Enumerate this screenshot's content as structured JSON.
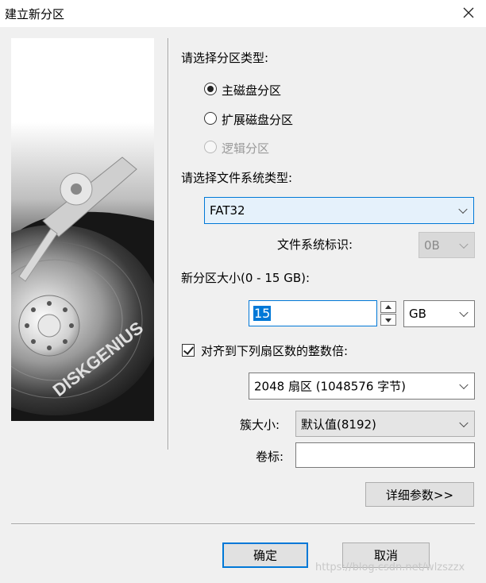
{
  "dialog": {
    "title": "建立新分区",
    "close_icon": "close-icon"
  },
  "illustration": {
    "brand_text": "DISKGENIUS",
    "icon": "hard-disk-icon"
  },
  "partition_type": {
    "label": "请选择分区类型:",
    "options": [
      {
        "label": "主磁盘分区",
        "checked": true,
        "enabled": true
      },
      {
        "label": "扩展磁盘分区",
        "checked": false,
        "enabled": true
      },
      {
        "label": "逻辑分区",
        "checked": false,
        "enabled": false
      }
    ]
  },
  "filesystem": {
    "label": "请选择文件系统类型:",
    "selected": "FAT32",
    "id_label": "文件系统标识:",
    "id_value": "0B"
  },
  "size": {
    "label": "新分区大小(0 - 15 GB):",
    "value": "15",
    "unit": "GB"
  },
  "align": {
    "checkbox_label": "对齐到下列扇区数的整数倍:",
    "checked": true,
    "selected": "2048 扇区 (1048576 字节)"
  },
  "cluster": {
    "label": "簇大小:",
    "selected": "默认值(8192)"
  },
  "volume": {
    "label": "卷标:",
    "value": ""
  },
  "buttons": {
    "details": "详细参数>>",
    "ok": "确定",
    "cancel": "取消"
  },
  "watermark": "https://blog.csdn.net/wlzszzx",
  "colors": {
    "accent": "#0078d7",
    "background": "#f0f0f0"
  }
}
